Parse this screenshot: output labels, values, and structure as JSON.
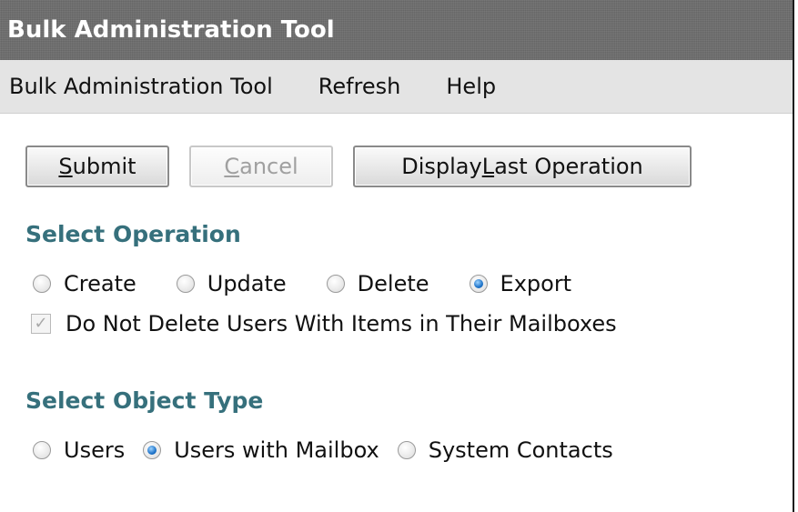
{
  "window": {
    "title": "Bulk Administration Tool"
  },
  "menu": {
    "items": [
      "Bulk Administration Tool",
      "Refresh",
      "Help"
    ]
  },
  "toolbar": {
    "submit": {
      "mnemonic": "S",
      "rest": "ubmit"
    },
    "cancel": {
      "mnemonic": "C",
      "rest": "ancel"
    },
    "display_last": {
      "before": "Display ",
      "mnemonic": "L",
      "after": "ast Operation"
    }
  },
  "select_operation": {
    "heading": "Select Operation",
    "options": [
      "Create",
      "Update",
      "Delete",
      "Export"
    ],
    "selected": "Export",
    "checkbox_label": "Do Not Delete Users With Items in Their Mailboxes",
    "checkbox_checked": true
  },
  "select_object_type": {
    "heading": "Select Object Type",
    "options": [
      "Users",
      "Users with Mailbox",
      "System Contacts"
    ],
    "selected": "Users with Mailbox"
  },
  "icons": {
    "checkmark": "checkmark-icon"
  },
  "colors": {
    "section_heading": "#36707c",
    "titlebar": "#6f6f6f",
    "menubar": "#e4e4e4",
    "radio_selected": "#1e73c9"
  }
}
